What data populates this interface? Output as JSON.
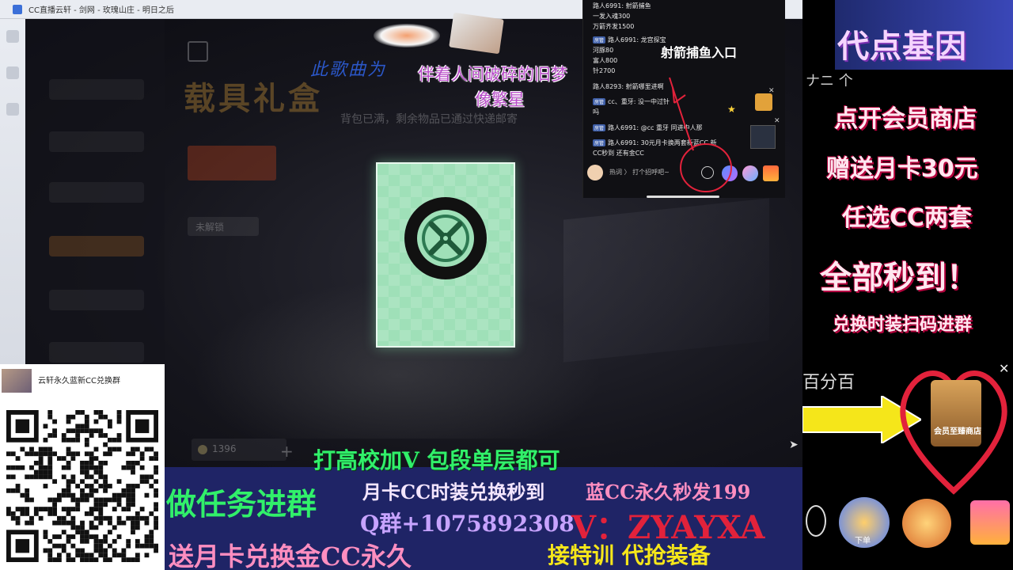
{
  "window": {
    "title": "CC直播云轩 - 剑网 - 玫瑰山庄 - 明日之后"
  },
  "lyrics": {
    "cursive": "此歌曲为",
    "line1": "伴着人间破碎的旧梦",
    "line2": "像繁星",
    "notice": "背包已满，剩余物品已通过快递邮寄"
  },
  "chat": {
    "lines": [
      {
        "tag": "",
        "text": "路人6991: 射箭捕鱼"
      },
      {
        "tag": "",
        "text": "一发入魂300"
      },
      {
        "tag": "",
        "text": "万箭齐发1500"
      },
      {
        "tag": "房管",
        "text": "路人6991: 龙宫探宝"
      },
      {
        "tag": "",
        "text": "河豚80"
      },
      {
        "tag": "",
        "text": "富人800"
      },
      {
        "tag": "",
        "text": "针2700"
      },
      {
        "tag": "",
        "text": "路人8293: 射箭哪里进啊"
      },
      {
        "tag": "房管",
        "text": "cc、重牙: 没一中过针"
      },
      {
        "tag": "",
        "text": "吗"
      },
      {
        "tag": "房管",
        "text": "路人6991: @cc 重牙 同进中人那"
      },
      {
        "tag": "房管",
        "text": "路人6991: 30元月卡换两套新蓝CC 新"
      },
      {
        "tag": "",
        "text": "CC秒到 还有金CC"
      }
    ],
    "fish_entry": "射箭捕鱼入口",
    "hot_label": "热词",
    "input_placeholder": "打个招呼吧~"
  },
  "right_panel": {
    "title": "代点基因",
    "top_strip": "ナニ 个",
    "promos": [
      "点开会员商店",
      "赠送月卡30元",
      "任选CC两套",
      "全部秒到！",
      "兑换时装扫码进群"
    ],
    "percent": "百分百",
    "emblem": "会员至臻商店",
    "bottom_caption": "下单",
    "close": "✕"
  },
  "qr": {
    "title": "云轩永久蓝新CC兑换群"
  },
  "banner": {
    "green": "打高校加V 包段单层都可",
    "left_big": "做任务进群",
    "mid1": "月卡CC时装兑换秒到",
    "right1": "蓝CC永久秒发199",
    "qq": "Q群+1075892308",
    "wechat": "V：ZYAYXA",
    "bottom_left": "送月卡兑换金CC永久",
    "bottom_right": "接特训 代抢装备"
  },
  "game": {
    "title_blur": "载具礼盒",
    "tab_blur": "未解锁",
    "coin": "1396"
  },
  "colors": {
    "card_green": "#9fe0b8",
    "banner_bg": "#1f2466",
    "accent_red": "#e2223b"
  }
}
